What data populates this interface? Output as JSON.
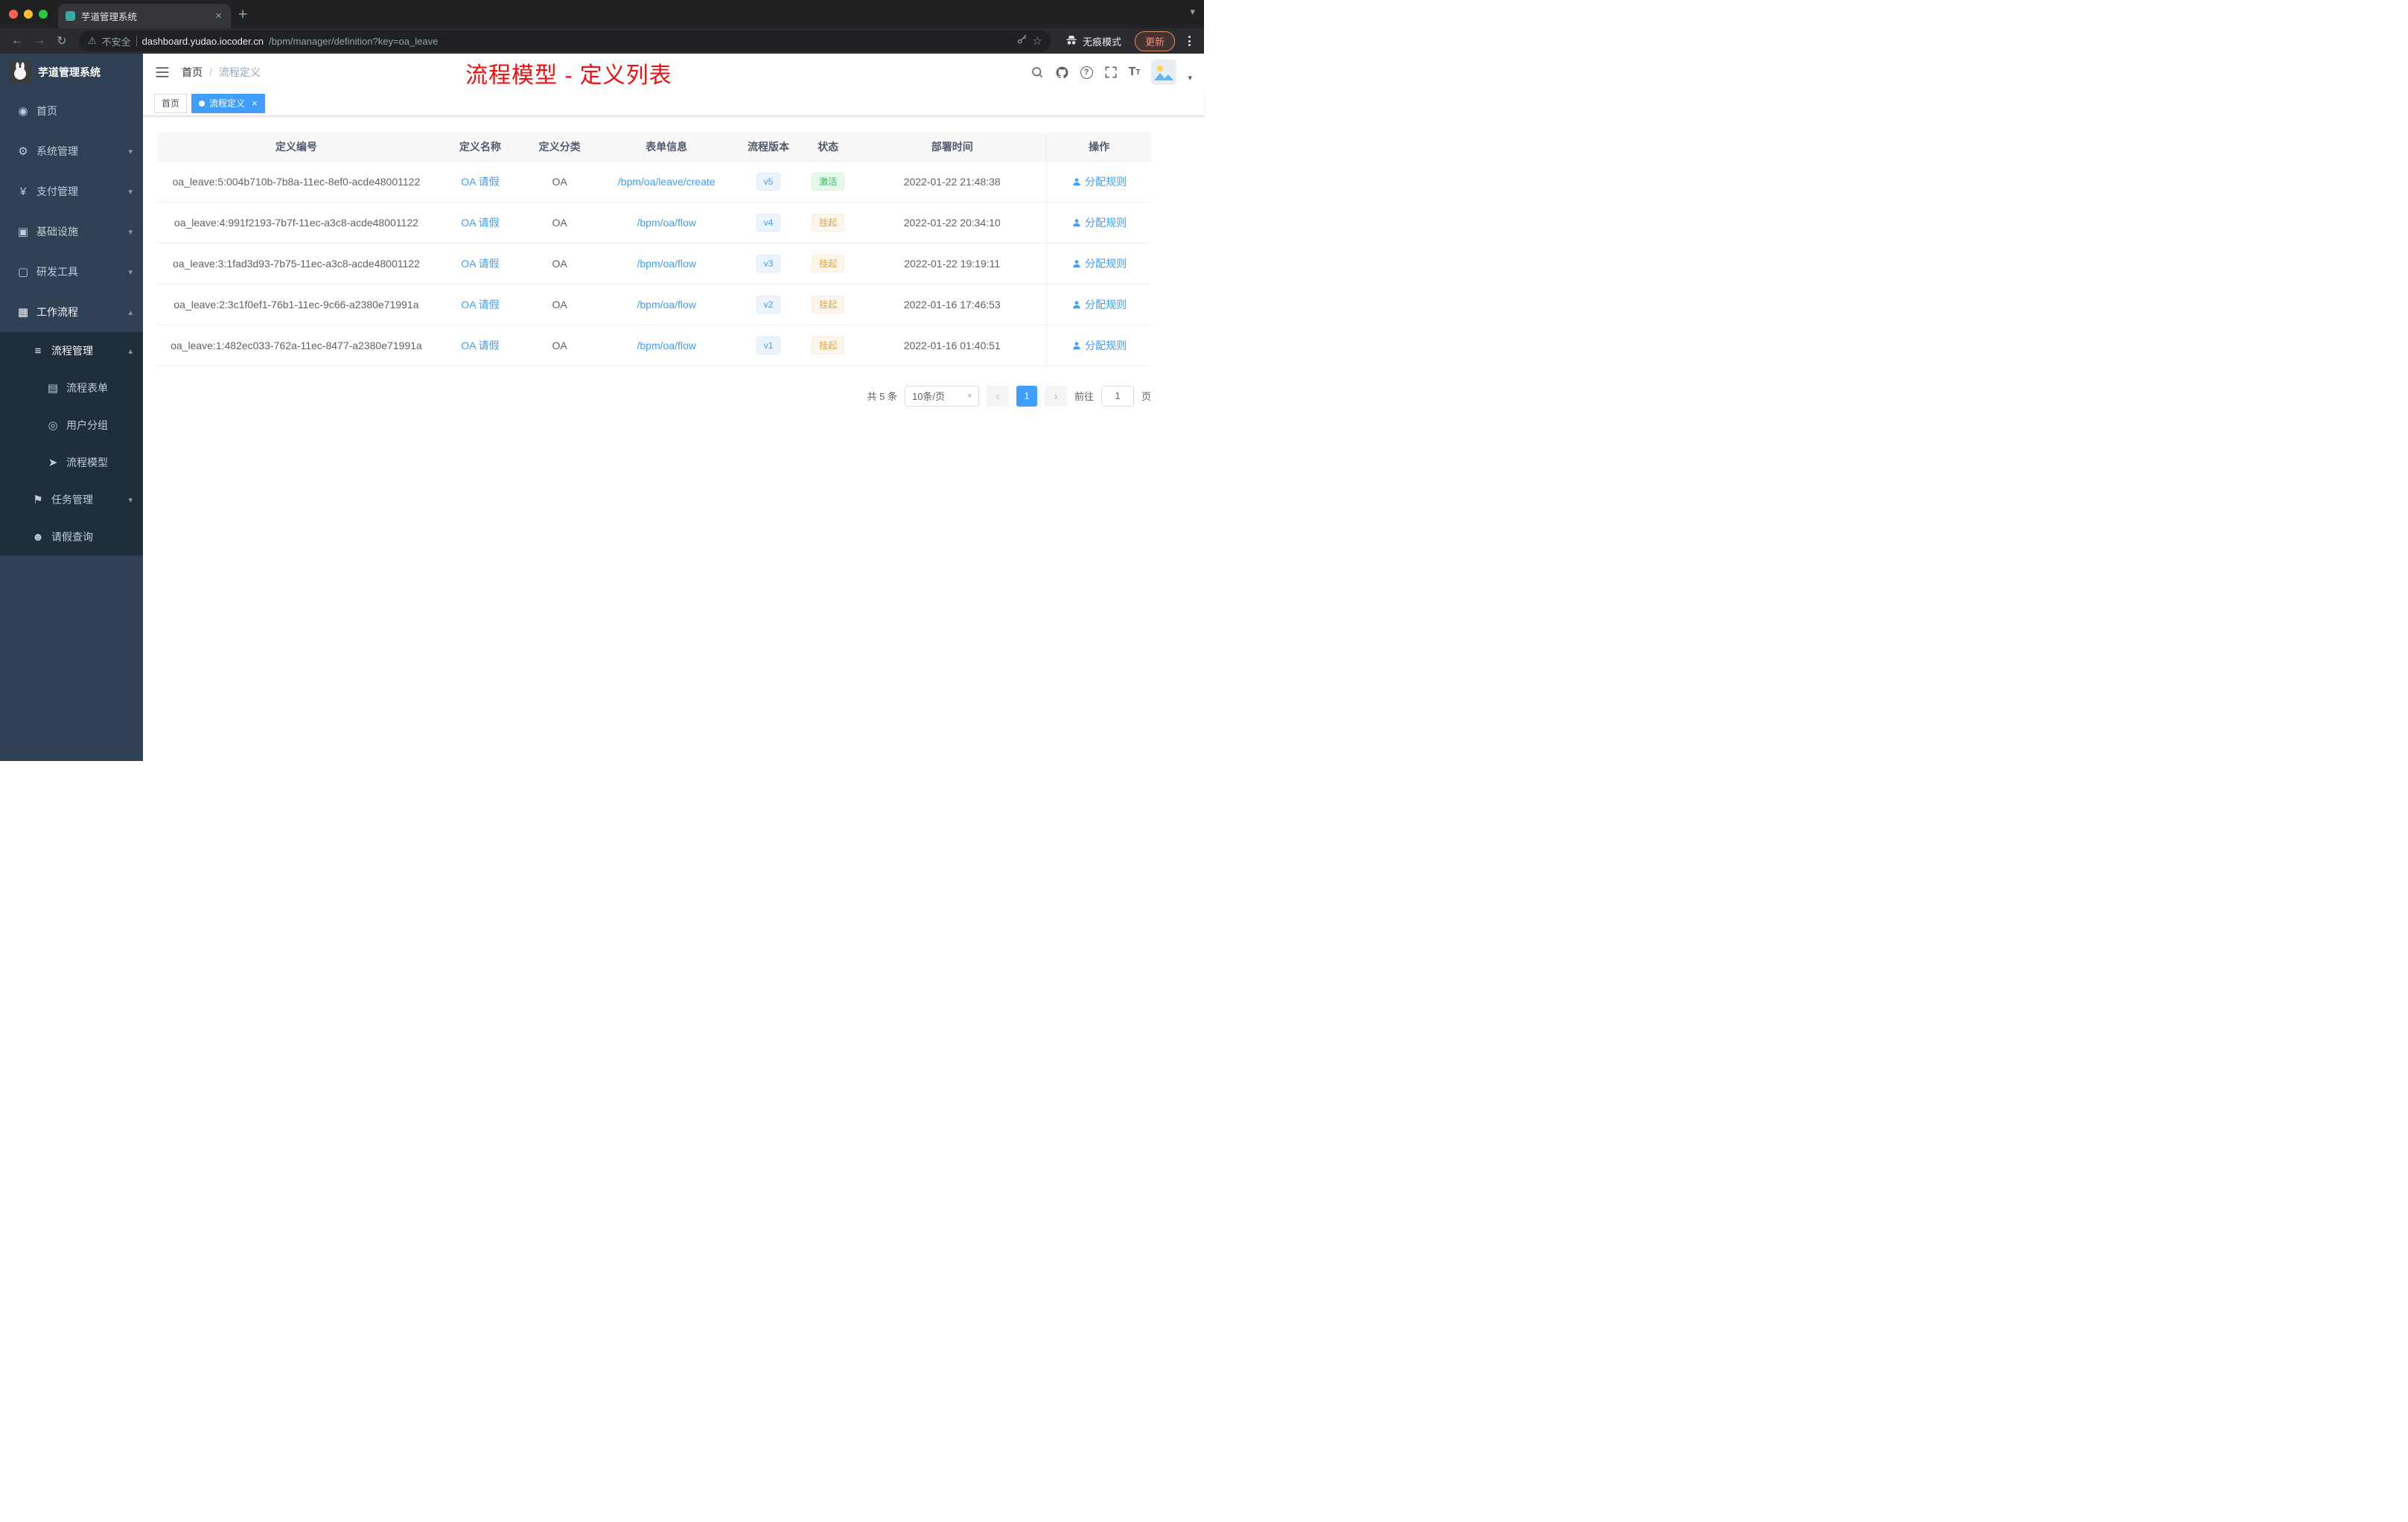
{
  "browser": {
    "tab_title": "芋道管理系统",
    "security_label": "不安全",
    "url_host": "dashboard.yudao.iocoder.cn",
    "url_path": "/bpm/manager/definition?key=oa_leave",
    "incognito_label": "无痕模式",
    "update_label": "更新"
  },
  "icons": {
    "back": "←",
    "forward": "→",
    "reload": "↻",
    "warning": "⚠",
    "star": "☆",
    "plus": "+",
    "close": "×",
    "caret_down": "▾",
    "caret_up": "▴",
    "chevron_left": "‹",
    "chevron_right": "›",
    "question": "?",
    "font_size": "T",
    "home": "◉",
    "gear": "⚙",
    "yen": "¥",
    "infra": "▣",
    "tools": "▢",
    "briefcase": "▦",
    "list": "≡",
    "form": "▤",
    "users": "◎",
    "send": "➤",
    "flag": "⚑",
    "user": "☻"
  },
  "colors": {
    "accent": "#409eff",
    "success": "#2ebd59",
    "warning": "#e6a23c",
    "title_red": "#f20c0c",
    "sidebar_bg": "#304156",
    "submenu_bg": "#1f2d3d"
  },
  "sidebar": {
    "app_title": "芋道管理系统",
    "items": [
      {
        "label": "首页"
      },
      {
        "label": "系统管理"
      },
      {
        "label": "支付管理"
      },
      {
        "label": "基础设施"
      },
      {
        "label": "研发工具"
      },
      {
        "label": "工作流程"
      },
      {
        "label": "流程管理"
      },
      {
        "label": "流程表单"
      },
      {
        "label": "用户分组"
      },
      {
        "label": "流程模型"
      },
      {
        "label": "任务管理"
      },
      {
        "label": "请假查询"
      }
    ]
  },
  "header": {
    "breadcrumb_home": "首页",
    "breadcrumb_sep": "/",
    "breadcrumb_current": "流程定义",
    "page_title": "流程模型 - 定义列表"
  },
  "tags": {
    "home": "首页",
    "active": "流程定义"
  },
  "table": {
    "headers": [
      "定义编号",
      "定义名称",
      "定义分类",
      "表单信息",
      "流程版本",
      "状态",
      "部署时间",
      "操作"
    ],
    "action_label": "分配规则",
    "rows": [
      {
        "id": "oa_leave:5:004b710b-7b8a-11ec-8ef0-acde48001122",
        "name": "OA 请假",
        "category": "OA",
        "form": "/bpm/oa/leave/create",
        "version": "v5",
        "status": "激活",
        "deploy_time": "2022-01-22 21:48:38"
      },
      {
        "id": "oa_leave:4:991f2193-7b7f-11ec-a3c8-acde48001122",
        "name": "OA 请假",
        "category": "OA",
        "form": "/bpm/oa/flow",
        "version": "v4",
        "status": "挂起",
        "deploy_time": "2022-01-22 20:34:10"
      },
      {
        "id": "oa_leave:3:1fad3d93-7b75-11ec-a3c8-acde48001122",
        "name": "OA 请假",
        "category": "OA",
        "form": "/bpm/oa/flow",
        "version": "v3",
        "status": "挂起",
        "deploy_time": "2022-01-22 19:19:11"
      },
      {
        "id": "oa_leave:2:3c1f0ef1-76b1-11ec-9c66-a2380e71991a",
        "name": "OA 请假",
        "category": "OA",
        "form": "/bpm/oa/flow",
        "version": "v2",
        "status": "挂起",
        "deploy_time": "2022-01-16 17:46:53"
      },
      {
        "id": "oa_leave:1:482ec033-762a-11ec-8477-a2380e71991a",
        "name": "OA 请假",
        "category": "OA",
        "form": "/bpm/oa/flow",
        "version": "v1",
        "status": "挂起",
        "deploy_time": "2022-01-16 01:40:51"
      }
    ]
  },
  "pagination": {
    "total_label": "共 5 条",
    "page_size_label": "10条/页",
    "current_page": "1",
    "goto_label": "前往",
    "goto_value": "1",
    "page_unit": "页"
  }
}
